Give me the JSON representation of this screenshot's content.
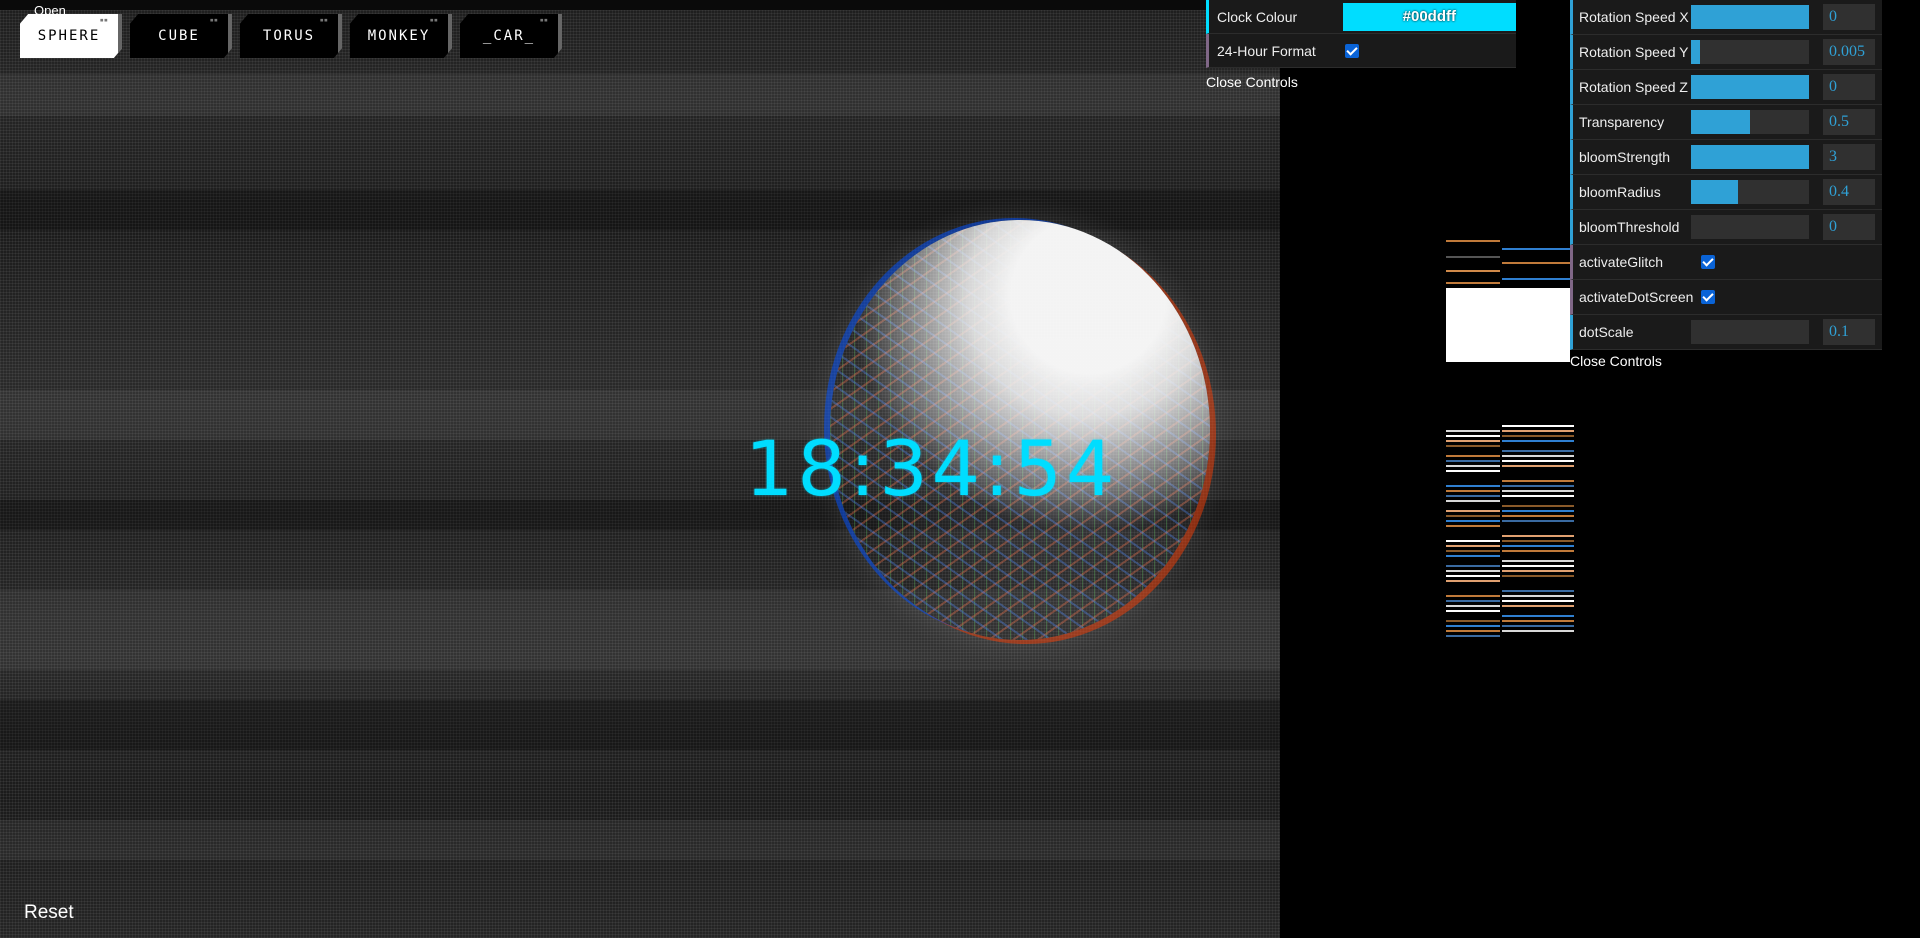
{
  "menu": {
    "open_label": "Open"
  },
  "tabs": [
    {
      "label": "SPHERE",
      "active": true
    },
    {
      "label": "CUBE",
      "active": false
    },
    {
      "label": "TORUS",
      "active": false
    },
    {
      "label": "MONKEY",
      "active": false
    },
    {
      "label": "_CAR_",
      "active": false
    }
  ],
  "clock": {
    "time": "18:34:54",
    "color": "#00ddff"
  },
  "reset_label": "Reset",
  "gui_clock": {
    "rows": [
      {
        "label": "Clock Colour",
        "type": "color",
        "value": "#00ddff"
      },
      {
        "label": "24-Hour Format",
        "type": "boolean",
        "value": true
      }
    ],
    "close_label": "Close Controls"
  },
  "gui_scene": {
    "rows": [
      {
        "label": "Rotation Speed X",
        "type": "number",
        "value": "0",
        "fill": 1.0
      },
      {
        "label": "Rotation Speed Y",
        "type": "number",
        "value": "0.005",
        "fill": 0.08
      },
      {
        "label": "Rotation Speed Z",
        "type": "number",
        "value": "0",
        "fill": 1.0
      },
      {
        "label": "Transparency",
        "type": "number",
        "value": "0.5",
        "fill": 0.5
      },
      {
        "label": "bloomStrength",
        "type": "number",
        "value": "3",
        "fill": 1.0
      },
      {
        "label": "bloomRadius",
        "type": "number",
        "value": "0.4",
        "fill": 0.4
      },
      {
        "label": "bloomThreshold",
        "type": "number",
        "value": "0",
        "fill": 0.0
      },
      {
        "label": "activateGlitch",
        "type": "boolean",
        "value": true
      },
      {
        "label": "activateDotScreen",
        "type": "boolean",
        "value": true
      },
      {
        "label": "dotScale",
        "type": "number",
        "value": "0.1",
        "fill": 0.0
      }
    ],
    "close_label": "Close Controls"
  },
  "colors": {
    "accent": "#2fa1d6",
    "clock": "#00ddff",
    "checkbox": "#0a63d6"
  }
}
